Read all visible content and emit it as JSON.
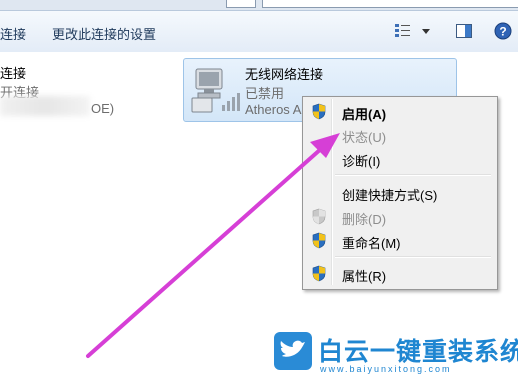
{
  "toolbar": {
    "cmd_connect_partial": "连接",
    "cmd_change_settings": "更改此连接的设置",
    "icons": [
      "view-options-icon",
      "dropdown-arrow-icon",
      "preview-pane-icon",
      "help-icon"
    ],
    "help_glyph": "?"
  },
  "left_connection": {
    "name_partial": "连接",
    "status_partial": "开连接",
    "device_partial": "OE)"
  },
  "wireless_connection": {
    "name": "无线网络连接",
    "status": "已禁用",
    "device": "Atheros A"
  },
  "context_menu": {
    "items": [
      {
        "label": "启用(A)",
        "bold": true,
        "disabled": false,
        "shield": true
      },
      {
        "label": "状态(U)",
        "bold": false,
        "disabled": true,
        "shield": false
      },
      {
        "label": "诊断(I)",
        "bold": false,
        "disabled": false,
        "shield": false
      },
      {
        "label": "创建快捷方式(S)",
        "bold": false,
        "disabled": false,
        "shield": false
      },
      {
        "label": "删除(D)",
        "bold": false,
        "disabled": true,
        "shield": true
      },
      {
        "label": "重命名(M)",
        "bold": false,
        "disabled": false,
        "shield": true
      },
      {
        "label": "属性(R)",
        "bold": false,
        "disabled": false,
        "shield": true
      }
    ]
  },
  "watermark": {
    "brand": "白云一键重装系统",
    "url": "www.baiyunxitong.com"
  },
  "colors": {
    "arrow": "#d63fd6",
    "shield_blue": "#2a6fc0",
    "shield_yellow": "#f2c21b",
    "brand_blue": "#1f86d1"
  }
}
